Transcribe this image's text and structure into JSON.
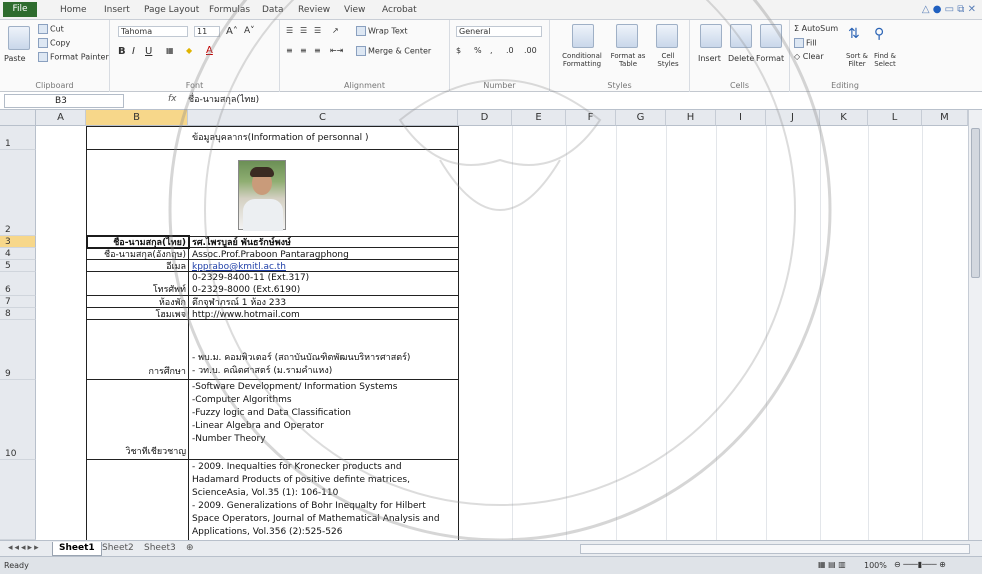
{
  "ribbon_tabs": [
    "File",
    "Home",
    "Insert",
    "Page Layout",
    "Formulas",
    "Data",
    "Review",
    "View",
    "Acrobat"
  ],
  "clipboard": {
    "paste": "Paste",
    "cut": "Cut",
    "copy": "Copy",
    "format_painter": "Format Painter",
    "label": "Clipboard"
  },
  "font": {
    "name": "Tahoma",
    "size": "11",
    "label": "Font",
    "bold": "B",
    "italic": "I",
    "underline": "U"
  },
  "alignment": {
    "wrap_text": "Wrap Text",
    "merge_center": "Merge & Center",
    "label": "Alignment"
  },
  "number": {
    "format": "General",
    "percent": "%",
    "label": "Number"
  },
  "styles": {
    "conditional": "Conditional Formatting",
    "format_table": "Format as Table",
    "cell_styles": "Cell Styles",
    "label": "Styles"
  },
  "cells": {
    "insert": "Insert",
    "delete": "Delete",
    "format": "Format",
    "label": "Cells"
  },
  "editing": {
    "autosum": "AutoSum",
    "fill": "Fill",
    "clear": "Clear",
    "sort_filter": "Sort & Filter",
    "find_select": "Find & Select",
    "label": "Editing"
  },
  "formula_bar": {
    "name_box": "B3",
    "fx": "fx",
    "content": "ชื่อ-นามสกุล(ไทย)"
  },
  "columns": [
    "A",
    "B",
    "C",
    "D",
    "E",
    "F",
    "G",
    "H",
    "I",
    "J",
    "K",
    "L",
    "M"
  ],
  "rows": [
    "1",
    "2",
    "3",
    "4",
    "5",
    "6",
    "7",
    "8",
    "9",
    "10"
  ],
  "sheet": {
    "title": "ข้อมูลบุคลากร(Information of personnal )",
    "r3": {
      "label": "ชื่อ-นามสกุล(ไทย)",
      "value": "รศ.ไพรบูลย์ พันธรักษ์พงษ์"
    },
    "r4": {
      "label": "ชื่อ-นามสกุล(อังกฤษ)",
      "value": "Assoc.Prof.Praboon Pantaragphong"
    },
    "r5": {
      "label": "อีเมล",
      "value": "kpprabo@kmitl.ac.th"
    },
    "r6": {
      "label": "โทรศัพท์",
      "value1": "0-2329-8400-11 (Ext.317)",
      "value2": "0-2329-8000 (Ext.6190)"
    },
    "r7": {
      "label": "ห้องพัก",
      "value": "ตึกจุฬาภรณ์ 1 ห้อง 233"
    },
    "r8": {
      "label": "โฮมเพจ",
      "value": "http://www.hotmail.com"
    },
    "r9": {
      "label": "การศึกษา",
      "value1": "- พบ.ม. คอมพิวเตอร์ (สถาบันบัณฑิตพัฒนบริหารศาสตร์)",
      "value2": "- วท.บ. คณิตศาสตร์ (ม.รามคำแหง)"
    },
    "r10": {
      "label": "วิชาที่เชี่ยวชาญ",
      "items": [
        "-Software Development/ Information Systems",
        "-Computer Algorithms",
        "-Fuzzy logic and Data Classification",
        "-Linear Algebra and Operator",
        "-Number Theory"
      ]
    },
    "r11": [
      "- 2009. Inequalties for Kronecker products and",
      "Hadamard Products of positive definte matrices,",
      "ScienceAsia, Vol.35 (1): 106-110",
      "- 2009. Generalizations of Bohr Inequalty for Hilbert",
      "Space Operators, Journal of Mathematical Analysis and",
      "Applications, Vol.356 (2):525-526"
    ]
  },
  "sheet_tabs": [
    "Sheet1",
    "Sheet2",
    "Sheet3"
  ],
  "status": {
    "ready": "Ready",
    "zoom": "100%"
  },
  "colors": {
    "file_tab": "#2e6c2e",
    "selected_header": "#f7d78a",
    "link": "#1f3fa8"
  }
}
